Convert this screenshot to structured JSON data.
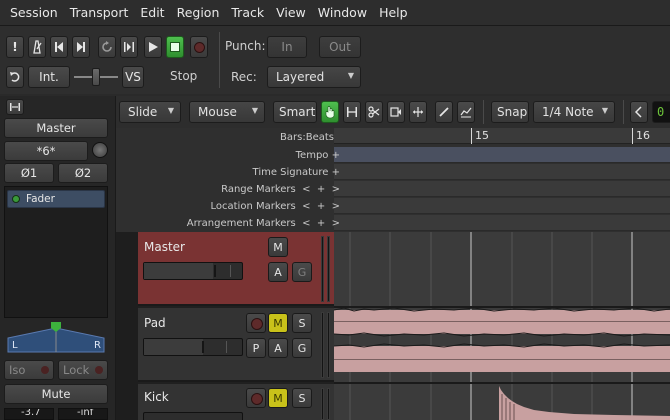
{
  "menu": [
    "Session",
    "Transport",
    "Edit",
    "Region",
    "Track",
    "View",
    "Window",
    "Help"
  ],
  "transport": {
    "int_label": "Int.",
    "vs_label": "VS",
    "status": "Stop",
    "punch_label": "Punch:",
    "punch_in": "In",
    "punch_out": "Out",
    "rec_label": "Rec:",
    "rec_mode": "Layered"
  },
  "editbar": {
    "slide": "Slide",
    "mouse": "Mouse",
    "smart": "Smart",
    "snap": "Snap",
    "grid": "1/4 Note"
  },
  "strip": {
    "name": "Master",
    "input": "*6*",
    "phase1": "Ø1",
    "phase2": "Ø2",
    "fader_label": "Fader",
    "pan_l": "L",
    "pan_r": "R",
    "iso": "Iso",
    "lock": "Lock",
    "mute": "Mute",
    "gain": "-3.7",
    "peak": "-inf"
  },
  "rulers": {
    "labels": [
      "Bars:Beats",
      "Tempo",
      "Time Signature",
      "Range Markers",
      "Location Markers",
      "Arrangement Markers"
    ],
    "bar15": "15",
    "bar16": "16"
  },
  "tracks": [
    {
      "name": "Master"
    },
    {
      "name": "Pad"
    },
    {
      "name": "Kick"
    }
  ],
  "buttons": {
    "m": "M",
    "a": "A",
    "g": "G",
    "s": "S",
    "p": "P"
  },
  "colors": {
    "master_track": "#7a3333",
    "waveform": "#c8a0a0",
    "punch_active": "#3aa33a",
    "mute_yellow": "#c9c21a",
    "grid_cursor_green": "#6dc43a"
  }
}
